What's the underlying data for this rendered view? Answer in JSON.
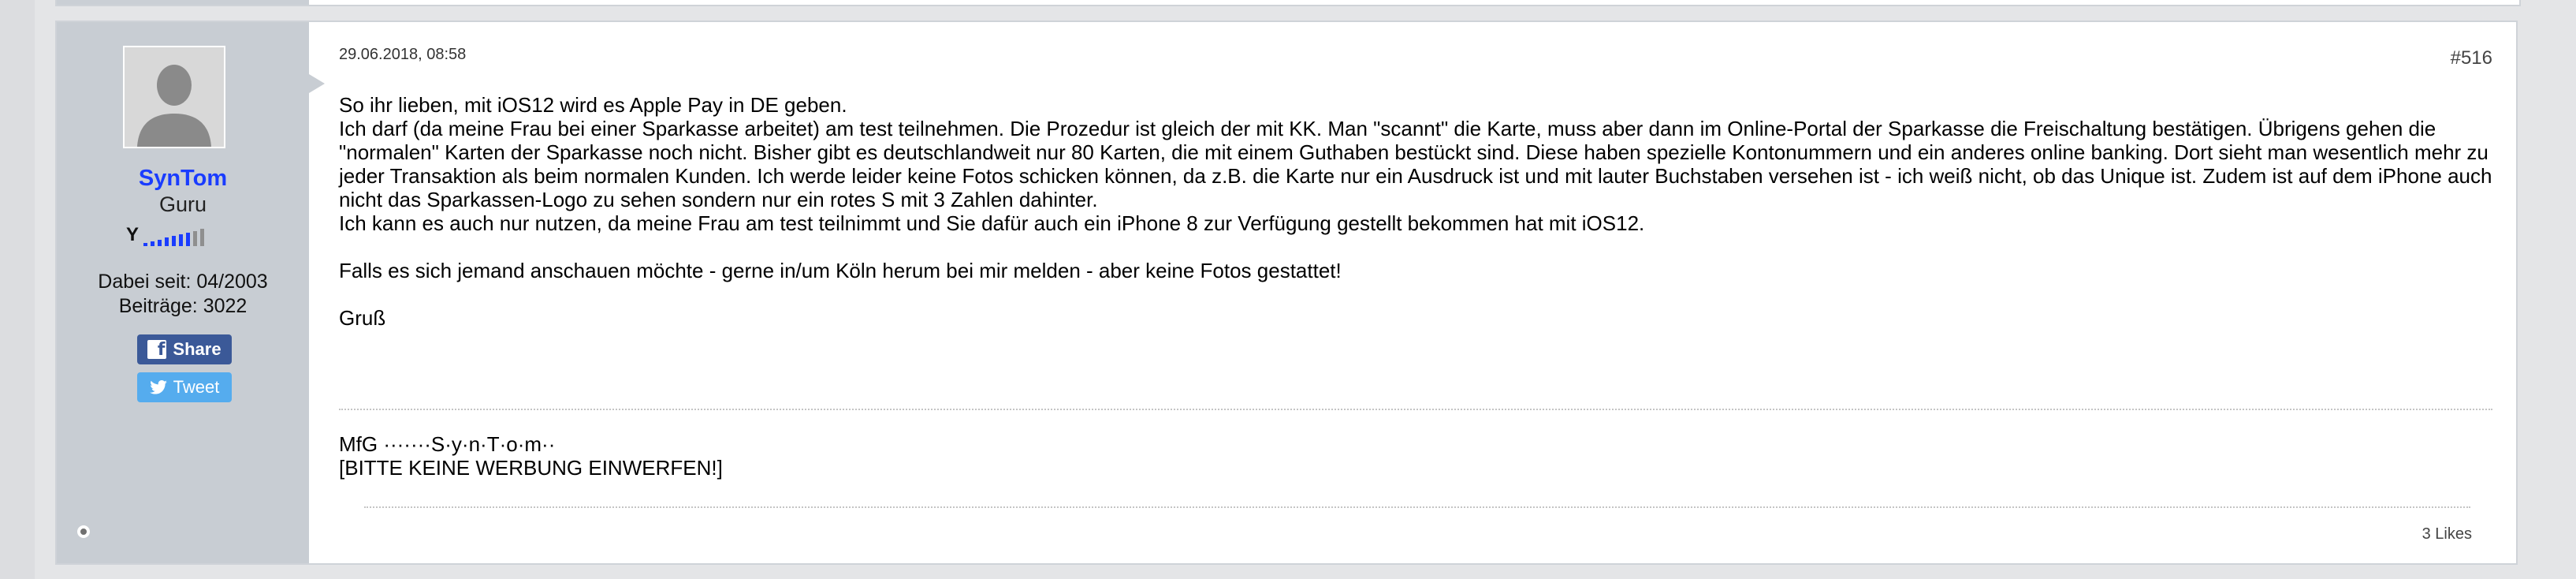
{
  "post": {
    "date": "29.06.2018, 08:58",
    "number": "#516",
    "likes": "3 Likes"
  },
  "user": {
    "name": "SynTom",
    "title": "Guru",
    "rank_bars_filled": 7,
    "rank_bars_total": 9,
    "member_since": "Dabei seit: 04/2003",
    "posts": "Beiträge: 3022",
    "share_label": "Share",
    "tweet_label": "Tweet"
  },
  "message": {
    "lines": [
      "So ihr lieben, mit iOS12 wird es Apple Pay in DE geben.",
      "Ich darf (da meine Frau bei einer Sparkasse arbeitet) am test teilnehmen. Die Prozedur ist gleich der mit KK. Man \"scannt\" die Karte, muss aber dann im Online-Portal der Sparkasse die Freischaltung bestätigen. Übrigens gehen die \"normalen\" Karten der Sparkasse noch nicht. Bisher gibt es deutschlandweit nur 80 Karten, die mit einem Guthaben bestückt sind. Diese haben spezielle Kontonummern und ein anderes online banking. Dort sieht man wesentlich mehr zu jeder Transaktion als beim normalen Kunden. Ich werde leider keine Fotos schicken können, da z.B. die Karte nur ein Ausdruck ist und mit lauter Buchstaben versehen ist - ich weiß nicht, ob das Unique ist. Zudem ist auf dem iPhone auch nicht das Sparkassen-Logo zu sehen sondern nur ein rotes S mit 3 Zahlen dahinter.",
      "Ich kann es auch nur nutzen, da meine Frau am test teilnimmt und Sie dafür auch ein iPhone 8 zur Verfügung gestellt bekommen hat mit iOS12.",
      "Falls es sich jemand anschauen möchte - gerne in/um Köln herum bei mir melden - aber keine Fotos gestattet!",
      "Gruß"
    ]
  },
  "signature": {
    "line1": "MfG ·······S·y·n·T·o·m··",
    "line2": "[BITTE KEINE WERBUNG EINWERFEN!]"
  },
  "icons": {
    "share": "facebook-icon",
    "tweet": "twitter-icon",
    "rank": "antenna-icon",
    "status": "offline-status-icon"
  },
  "colors": {
    "username": "#1a3cff",
    "share_bg": "#3b5998",
    "tweet_bg": "#55acee",
    "sidebar_bg": "#c8cdd3"
  }
}
